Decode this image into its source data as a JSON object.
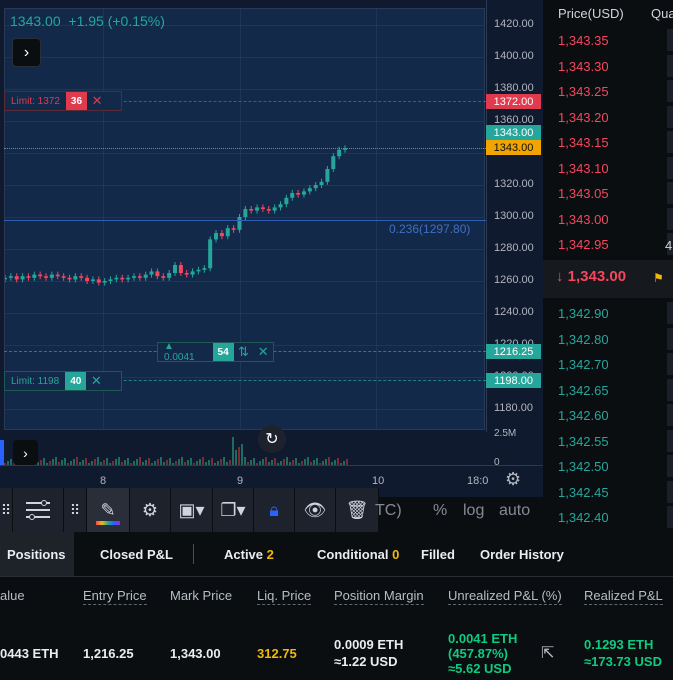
{
  "ticker": {
    "price": "1343.00",
    "change": "+1.95 (+0.15%)"
  },
  "price_axis": {
    "ticks": [
      "1420.00",
      "1400.00",
      "1380.00",
      "1360.00",
      "1340.00",
      "1320.00",
      "1300.00",
      "1280.00",
      "1260.00",
      "1240.00",
      "1220.00",
      "1200.00",
      "1180.00"
    ],
    "tags": [
      {
        "text": "1372.00",
        "color": "#e03a4e"
      },
      {
        "text": "1343.00",
        "color": "#26a69a"
      },
      {
        "text": "1343.00",
        "color": "#f0a500"
      },
      {
        "text": "1216.25",
        "color": "#26a69a"
      },
      {
        "text": "1198.00",
        "color": "#26a69a"
      }
    ]
  },
  "orders": {
    "limit_sell": {
      "label": "Limit: 1372",
      "qty": "36",
      "close": "✕"
    },
    "position": {
      "label": "▲ 0.0041",
      "qty": "54",
      "arrows": "⇅",
      "close": "✕"
    },
    "limit_buy": {
      "label": "Limit: 1198",
      "qty": "40",
      "close": "✕"
    }
  },
  "fib_label": "0.236(1297.80)",
  "volume_axis": {
    "top": "2.5M",
    "zero": "0"
  },
  "time_axis": {
    "labels": [
      "8",
      "9",
      "10",
      "18:0"
    ]
  },
  "toolbar": {
    "scale_left": "TC)",
    "percent": "%",
    "log": "log",
    "auto": "auto"
  },
  "order_book": {
    "headers": {
      "price": "Price(USD)",
      "qty": "Qua"
    },
    "asks": [
      "1,343.35",
      "1,343.30",
      "1,343.25",
      "1,343.20",
      "1,343.15",
      "1,343.10",
      "1,343.05",
      "1,343.00",
      "1,342.95"
    ],
    "mid_price": "↓ 1,343.00",
    "mid_side": "4",
    "bids": [
      "1,342.90",
      "1,342.80",
      "1,342.70",
      "1,342.65",
      "1,342.60",
      "1,342.55",
      "1,342.50",
      "1,342.45",
      "1,342.40"
    ]
  },
  "tabs": {
    "positions": "Positions",
    "closed_pnl": "Closed P&L",
    "active": "Active",
    "active_count": "2",
    "conditional": "Conditional",
    "conditional_count": "0",
    "filled": "Filled",
    "order_history": "Order History"
  },
  "positions_table": {
    "headers": [
      "alue",
      "Entry Price",
      "Mark Price",
      "Liq. Price",
      "Position Margin",
      "Unrealized P&L (%)",
      "Realized P&L"
    ],
    "row": {
      "value": "0443 ETH",
      "entry_price": "1,216.25",
      "mark_price": "1,343.00",
      "liq_price": "312.75",
      "margin_line1": "0.0009 ETH",
      "margin_line2": "≈1.22 USD",
      "upnl_line1": "0.0041 ETH",
      "upnl_line2": "(457.87%)",
      "upnl_line3": "≈5.62 USD",
      "rpnl_line1": "0.1293 ETH",
      "rpnl_line2": "≈173.73 USD"
    }
  },
  "colors": {
    "up": "#26a69a",
    "down": "#f6465d",
    "accent": "#f0b90b"
  },
  "chart_data": {
    "type": "candlestick",
    "title": "",
    "ylim": [
      1170,
      1430
    ],
    "x_ticks": [
      "8",
      "9",
      "10",
      "18:0"
    ],
    "series": [
      {
        "values": [
          1262,
          1263,
          1261,
          1263,
          1262,
          1264,
          1263,
          1262,
          1264,
          1263,
          1262,
          1261,
          1263,
          1262,
          1260,
          1261,
          1259,
          1260,
          1261,
          1262,
          1261,
          1262,
          1263,
          1262,
          1264,
          1266,
          1263,
          1262,
          1265,
          1270,
          1265,
          1264,
          1266,
          1267,
          1268,
          1286,
          1290,
          1288,
          1293,
          1292,
          1300,
          1305,
          1304,
          1306,
          1305,
          1304,
          1306,
          1308,
          1312,
          1315,
          1314,
          1316,
          1318,
          1320,
          1322,
          1330,
          1338,
          1342,
          1343
        ]
      }
    ]
  }
}
